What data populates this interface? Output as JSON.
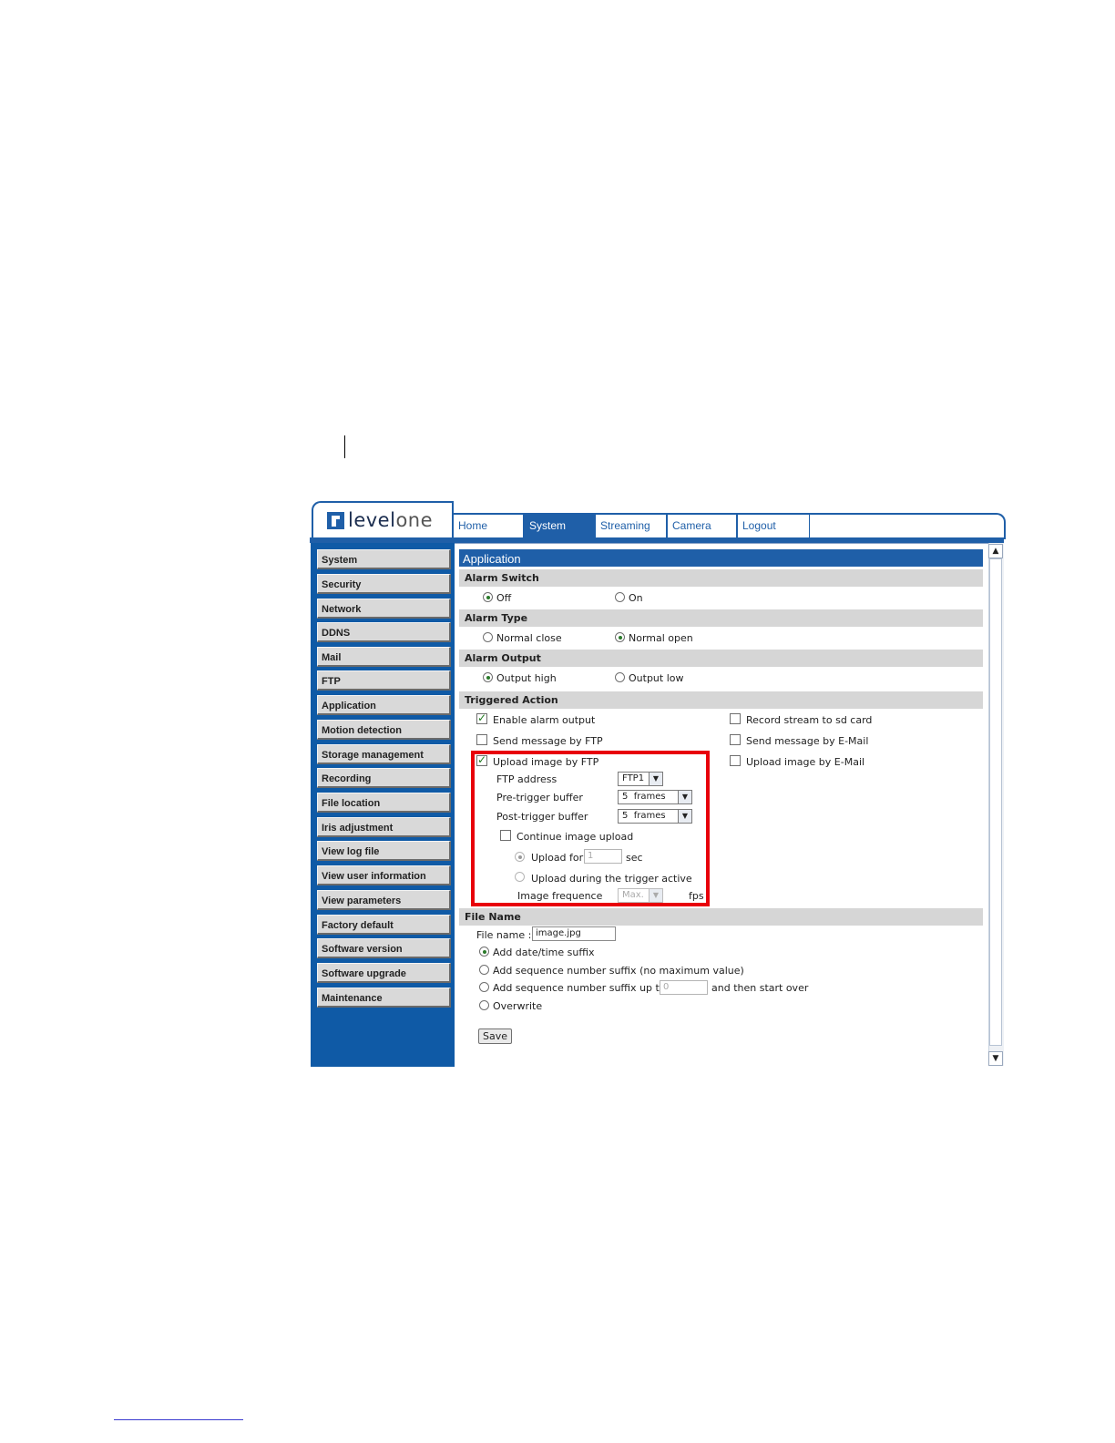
{
  "logo": {
    "text_level": "level",
    "text_one": "one"
  },
  "tabs": [
    "Home",
    "System",
    "Streaming",
    "Camera",
    "Logout"
  ],
  "sidebar": [
    "System",
    "Security",
    "Network",
    "DDNS",
    "Mail",
    "FTP",
    "Application",
    "Motion detection",
    "Storage management",
    "Recording",
    "File location",
    "Iris adjustment",
    "View log file",
    "View user information",
    "View parameters",
    "Factory default",
    "Software version",
    "Software upgrade",
    "Maintenance"
  ],
  "page_title": "Application",
  "alarm_switch": {
    "title": "Alarm Switch",
    "off": "Off",
    "on": "On",
    "selected": "Off"
  },
  "alarm_type": {
    "title": "Alarm Type",
    "normal_close": "Normal close",
    "normal_open": "Normal open",
    "selected": "Normal open"
  },
  "alarm_output": {
    "title": "Alarm Output",
    "high": "Output high",
    "low": "Output low",
    "selected": "Output high"
  },
  "triggered": {
    "title": "Triggered Action",
    "enable_alarm_output": "Enable alarm output",
    "send_message_ftp": "Send message by FTP",
    "upload_image_ftp": "Upload image by FTP",
    "record_sd": "Record stream to sd card",
    "send_message_email": "Send message by E-Mail",
    "upload_image_email": "Upload image by E-Mail",
    "ftp_address_label": "FTP address",
    "ftp_address_value": "FTP1",
    "pre_trigger_label": "Pre-trigger buffer",
    "pre_trigger_value": "5  frames",
    "post_trigger_label": "Post-trigger buffer",
    "post_trigger_value": "5  frames",
    "continue_upload": "Continue image upload",
    "upload_for": "Upload for",
    "upload_for_value": "1",
    "sec": "sec",
    "upload_during": "Upload during the trigger active",
    "image_frequence": "Image frequence",
    "frequence_value": "Max.",
    "fps": "fps"
  },
  "file_name": {
    "title": "File Name",
    "label": "File name :",
    "value": "image.jpg",
    "opt_datetime": "Add date/time suffix",
    "opt_seq": "Add sequence number suffix (no maximum value)",
    "opt_seq_upto": "Add sequence number suffix up to",
    "seq_upto_value": "0",
    "then_start_over": "and then start over",
    "opt_overwrite": "Overwrite",
    "selected": "Add date/time suffix"
  },
  "save_label": "Save",
  "colors": {
    "brand_blue": "#1f5fa8",
    "highlight_red": "#e8000b",
    "section_gray": "#d6d6d6"
  }
}
